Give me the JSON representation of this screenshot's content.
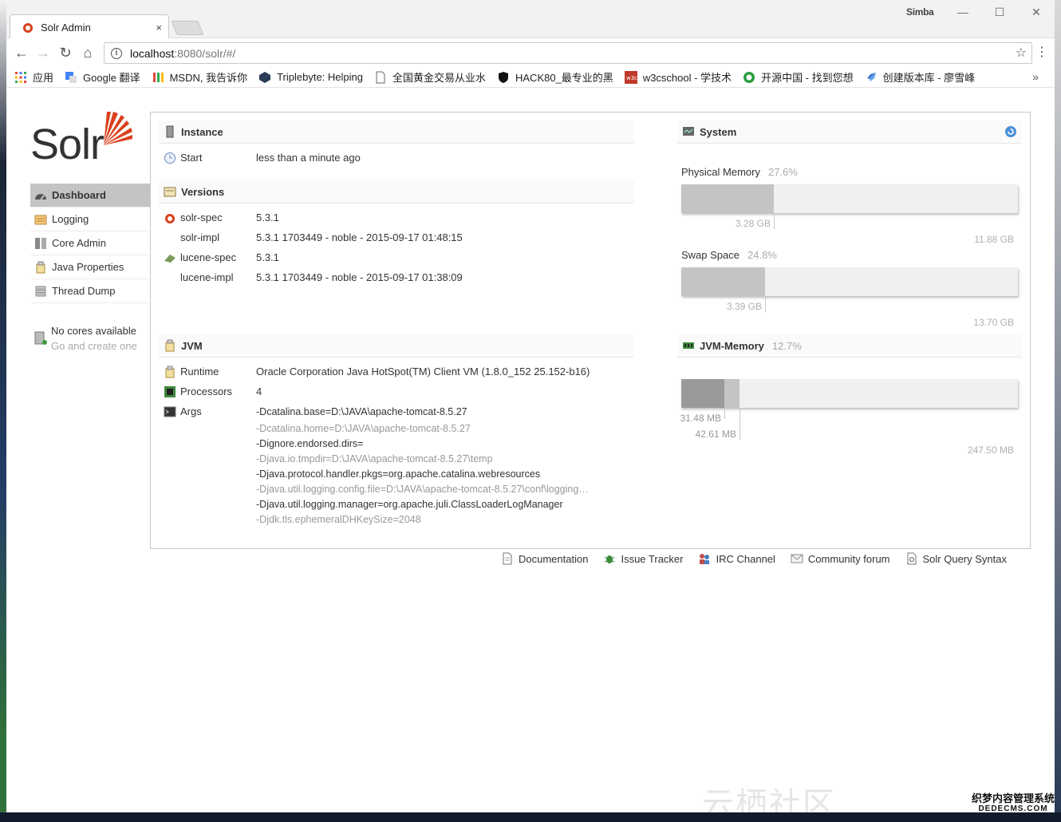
{
  "browser": {
    "tab_title": "Solr Admin",
    "tab_close": "×",
    "user_name": "Simba",
    "window_controls": {
      "minimize": "—",
      "maximize": "☐",
      "close": "✕"
    },
    "url_host": "localhost",
    "url_rest": ":8080/solr/#/",
    "bookmarks": [
      {
        "label": "应用",
        "icon": "apps-grid-icon"
      },
      {
        "label": "Google 翻译",
        "icon": "google-translate-icon"
      },
      {
        "label": "MSDN, 我告诉你",
        "icon": "msdn-icon"
      },
      {
        "label": "Triplebyte: Helping",
        "icon": "triplebyte-icon"
      },
      {
        "label": "全国黄金交易从业水",
        "icon": "page-icon"
      },
      {
        "label": "HACK80_最专业的黑",
        "icon": "shield-icon"
      },
      {
        "label": "w3cschool - 学技术",
        "icon": "w3c-icon"
      },
      {
        "label": "开源中国 - 找到您想",
        "icon": "oschina-icon"
      },
      {
        "label": "创建版本库 - 廖雪峰",
        "icon": "rocket-icon"
      }
    ],
    "bookmarks_more": "»"
  },
  "solr": {
    "logo_text": "Solr",
    "menu": [
      {
        "label": "Dashboard",
        "active": true
      },
      {
        "label": "Logging"
      },
      {
        "label": "Core Admin"
      },
      {
        "label": "Java Properties"
      },
      {
        "label": "Thread Dump"
      }
    ],
    "cores": {
      "title": "No cores available",
      "sub": "Go and create one"
    },
    "instance": {
      "heading": "Instance",
      "start_label": "Start",
      "start_value": "less than a minute ago"
    },
    "versions": {
      "heading": "Versions",
      "rows": [
        {
          "label": "solr-spec",
          "value": "5.3.1"
        },
        {
          "label": "solr-impl",
          "value": "5.3.1 1703449 - noble - 2015-09-17 01:48:15"
        },
        {
          "label": "lucene-spec",
          "value": "5.3.1"
        },
        {
          "label": "lucene-impl",
          "value": "5.3.1 1703449 - noble - 2015-09-17 01:38:09"
        }
      ]
    },
    "jvm": {
      "heading": "JVM",
      "runtime_label": "Runtime",
      "runtime_value": "Oracle Corporation Java HotSpot(TM) Client VM (1.8.0_152 25.152-b16)",
      "processors_label": "Processors",
      "processors_value": "4",
      "args_label": "Args",
      "args": [
        "-Dcatalina.base=D:\\JAVA\\apache-tomcat-8.5.27",
        "-Dcatalina.home=D:\\JAVA\\apache-tomcat-8.5.27",
        "-Dignore.endorsed.dirs=",
        "-Djava.io.tmpdir=D:\\JAVA\\apache-tomcat-8.5.27\\temp",
        "-Djava.protocol.handler.pkgs=org.apache.catalina.webresources",
        "-Djava.util.logging.config.file=D:\\JAVA\\apache-tomcat-8.5.27\\conf\\logging…",
        "-Djava.util.logging.manager=org.apache.juli.ClassLoaderLogManager",
        "-Djdk.tls.ephemeralDHKeySize=2048"
      ]
    },
    "system": {
      "heading": "System",
      "physical": {
        "label": "Physical Memory",
        "pct": "27.6%",
        "used": "3.28 GB",
        "total": "11.88 GB",
        "fraction": 0.276
      },
      "swap": {
        "label": "Swap Space",
        "pct": "24.8%",
        "used": "3.39 GB",
        "total": "13.70 GB",
        "fraction": 0.248
      }
    },
    "jvm_memory": {
      "heading": "JVM-Memory",
      "pct": "12.7%",
      "used": "31.48 MB",
      "committed": "42.61 MB",
      "max": "247.50 MB",
      "used_fraction": 0.127,
      "committed_fraction": 0.172
    },
    "footer": [
      {
        "label": "Documentation",
        "icon": "document-icon"
      },
      {
        "label": "Issue Tracker",
        "icon": "bug-icon"
      },
      {
        "label": "IRC Channel",
        "icon": "irc-icon"
      },
      {
        "label": "Community forum",
        "icon": "mail-icon"
      },
      {
        "label": "Solr Query Syntax",
        "icon": "query-icon"
      }
    ]
  },
  "watermark": {
    "text": "云栖社区 yq.aliyun.com",
    "site": "织梦内容管理系统",
    "domain": "DEDECMS.COM"
  },
  "colors": {
    "solr_orange": "#d9411e",
    "active_menu": "#c4c4c4",
    "bar_fill": "#c4c4c4",
    "bar_used": "#9a9a9a"
  }
}
